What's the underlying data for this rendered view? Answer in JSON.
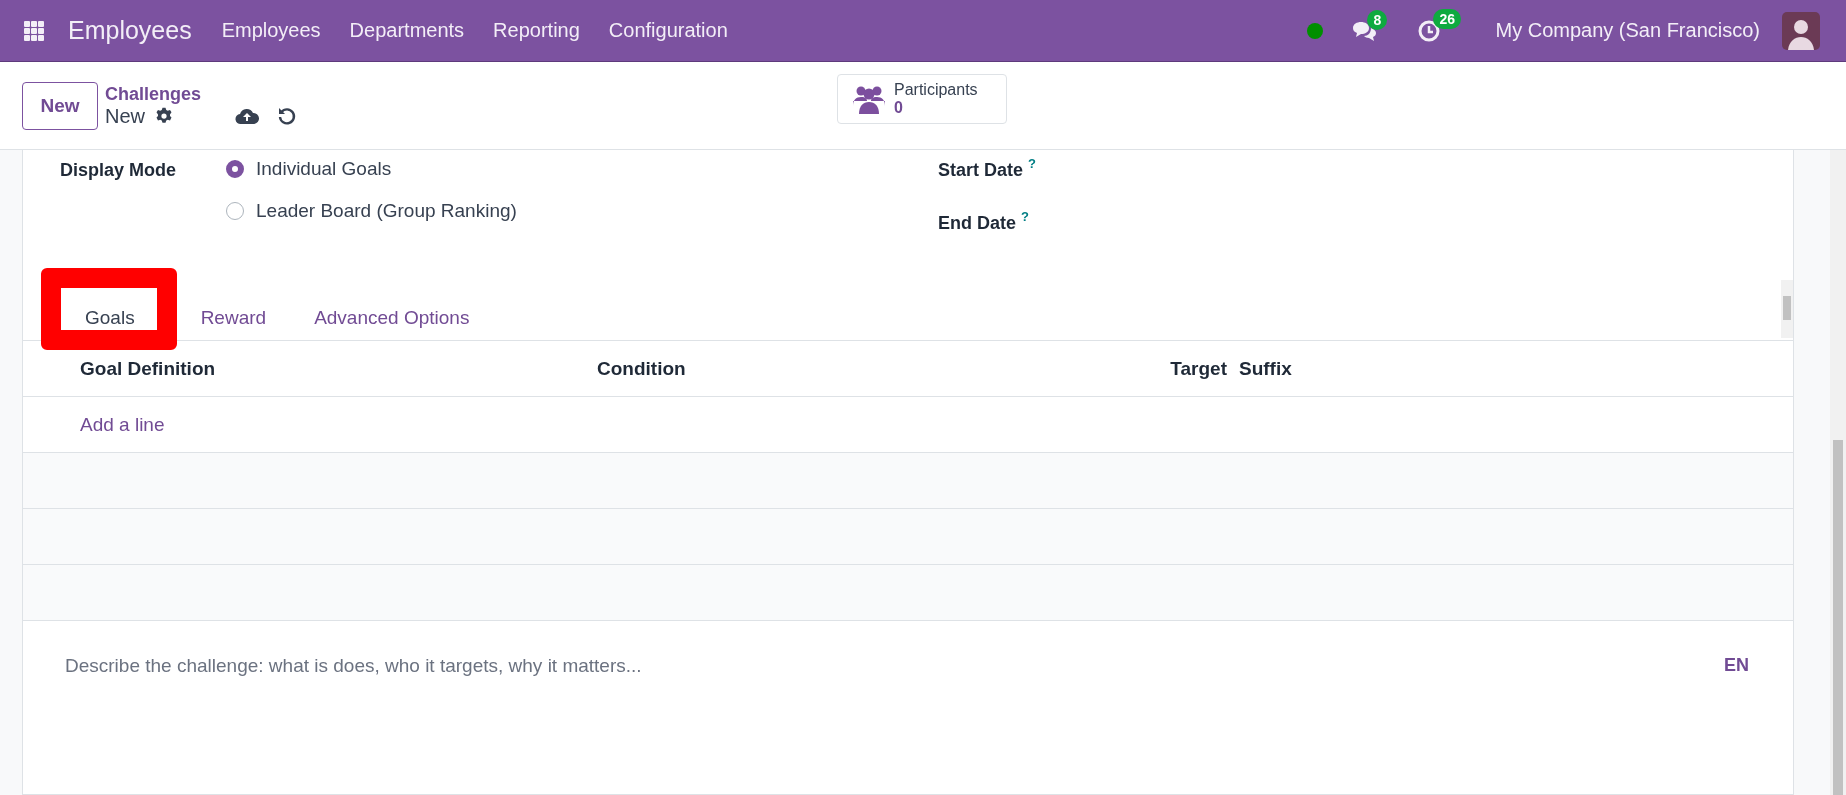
{
  "navbar": {
    "app_name": "Employees",
    "menu": [
      "Employees",
      "Departments",
      "Reporting",
      "Configuration"
    ],
    "messages_count": "8",
    "activities_count": "26",
    "company": "My Company (San Francisco)"
  },
  "control_panel": {
    "new_button": "New",
    "breadcrumb": "Challenges",
    "record_name": "New",
    "smart_button": {
      "label": "Participants",
      "count": "0"
    }
  },
  "form": {
    "display_mode": {
      "label": "Display Mode",
      "options": [
        {
          "label": "Individual Goals",
          "selected": true
        },
        {
          "label": "Leader Board (Group Ranking)",
          "selected": false
        }
      ]
    },
    "dates": [
      {
        "label": "Start Date",
        "help": "?"
      },
      {
        "label": "End Date",
        "help": "?"
      }
    ],
    "tabs": [
      {
        "label": "Goals",
        "selected": true,
        "highlighted": true
      },
      {
        "label": "Reward",
        "selected": false,
        "highlighted": false
      },
      {
        "label": "Advanced Options",
        "selected": false,
        "highlighted": false
      }
    ],
    "goals_table": {
      "columns": [
        "Goal Definition",
        "Condition",
        "Target",
        "Suffix"
      ],
      "add_line": "Add a line"
    },
    "description": {
      "placeholder": "Describe the challenge: what is does, who it targets, why it matters...",
      "language": "EN"
    }
  }
}
